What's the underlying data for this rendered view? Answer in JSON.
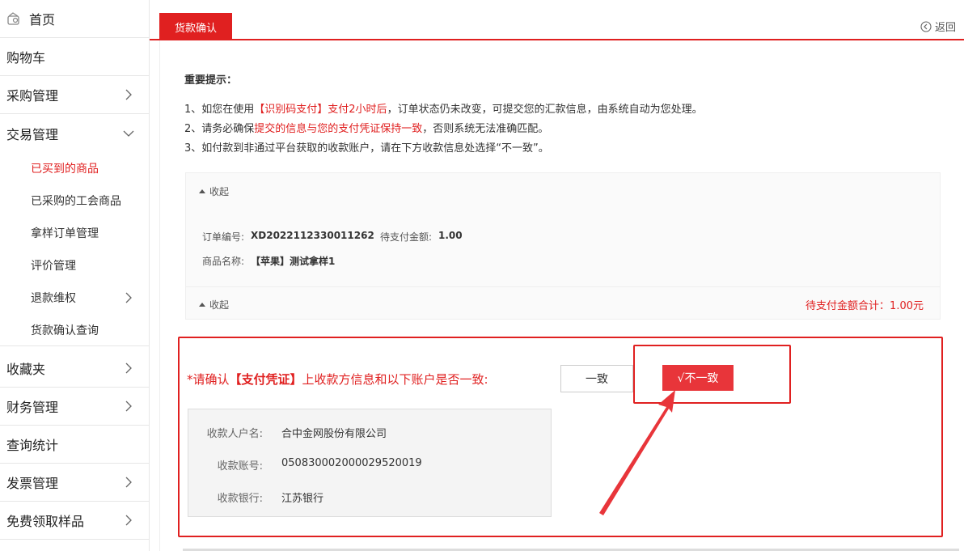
{
  "sidebar": {
    "home": "首页",
    "items": [
      {
        "label": "购物车"
      },
      {
        "label": "采购管理"
      },
      {
        "label": "交易管理"
      },
      {
        "label": "收藏夹"
      },
      {
        "label": "财务管理"
      },
      {
        "label": "查询统计"
      },
      {
        "label": "发票管理"
      },
      {
        "label": "免费领取样品"
      }
    ],
    "sub_items": [
      {
        "label": "已买到的商品"
      },
      {
        "label": "已采购的工会商品"
      },
      {
        "label": "拿样订单管理"
      },
      {
        "label": "评价管理"
      },
      {
        "label": "退款维权"
      },
      {
        "label": "货款确认查询"
      }
    ],
    "active_color": "#e02020"
  },
  "header": {
    "tab": "货款确认",
    "back": "返回"
  },
  "notice": {
    "title": "重要提示：",
    "l1_a": "1、如您在使用",
    "l1_b": "【识别码支付】支付2小时后",
    "l1_c": "，订单状态仍未改变，可提交您的汇款信息，由系统自动为您处理。",
    "l2_a": "2、请务必确保",
    "l2_b": "提交的信息与您的支付凭证保持一致",
    "l2_c": "，否则系统无法准确匹配。",
    "l3": "3、如付款到非通过平台获取的收款账户，请在下方收款信息处选择“不一致”。"
  },
  "order": {
    "collapse_label": "收起",
    "order_no_label": "订单编号:",
    "order_no": "XD2022112330011262",
    "amount_label": "待支付金额:",
    "amount": "1.00",
    "product_label": "商品名称:",
    "product": "【苹果】测试拿样1",
    "total": "待支付金额合计：1.00元"
  },
  "confirm": {
    "q_a": "*请确认",
    "q_b": "【支付凭证】",
    "q_c": "上收款方信息和以下账户是否一致:",
    "yes": "一致",
    "no": "√不一致",
    "payee_label": "收款人户名:",
    "payee": "合中金网股份有限公司",
    "account_label": "收款账号:",
    "account": "05083000200002952001​9",
    "bank_label": "收款银行:",
    "bank": "江苏银行"
  }
}
